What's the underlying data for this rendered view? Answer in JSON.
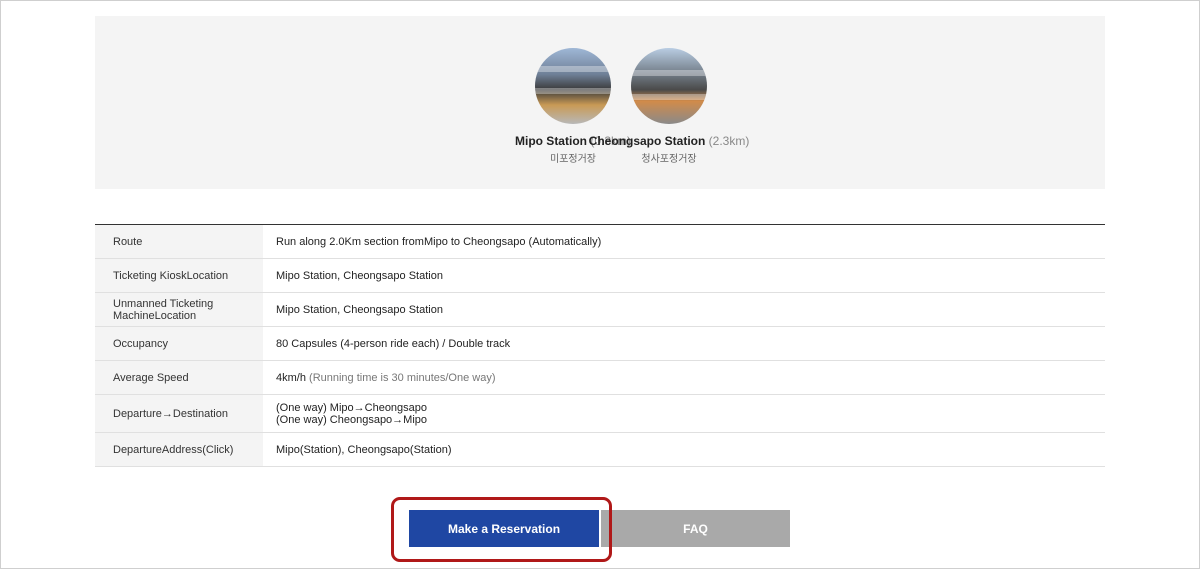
{
  "stations": [
    {
      "name": "Mipo Station",
      "distance": "(0.3km)",
      "korean": "미포정거장",
      "image_icon": "station-photo"
    },
    {
      "name": "Cheongsapo Station",
      "distance": "(2.3km)",
      "korean": "청사포정거장",
      "image_icon": "station-photo"
    }
  ],
  "info_rows": {
    "route": {
      "label": "Route",
      "value": "Run along 2.0Km section fromMipo to Cheongsapo (Automatically)"
    },
    "kiosk": {
      "label": "Ticketing KioskLocation",
      "value": "Mipo Station, Cheongsapo Station"
    },
    "unmanned": {
      "label_line1": "Unmanned Ticketing",
      "label_line2": "MachineLocation",
      "value": "Mipo Station, Cheongsapo Station"
    },
    "occupancy": {
      "label": "Occupancy",
      "value": "80 Capsules (4-person ride each) / Double track"
    },
    "speed": {
      "label": "Average Speed",
      "value_main": "4km/h",
      "value_note": " (Running time is 30 minutes/One way)"
    },
    "direction": {
      "label": "Departure→Destination",
      "line1": "(One way) Mipo→Cheongsapo",
      "line2": "(One way) Cheongsapo→Mipo"
    },
    "address": {
      "label": "DepartureAddress(Click)",
      "value": "Mipo(Station), Cheongsapo(Station)"
    }
  },
  "buttons": {
    "reserve": "Make a Reservation",
    "faq": "FAQ"
  },
  "colors": {
    "reserve_bg": "#1f47a3",
    "faq_bg": "#a9a9a9",
    "highlight_border": "#b01818"
  }
}
